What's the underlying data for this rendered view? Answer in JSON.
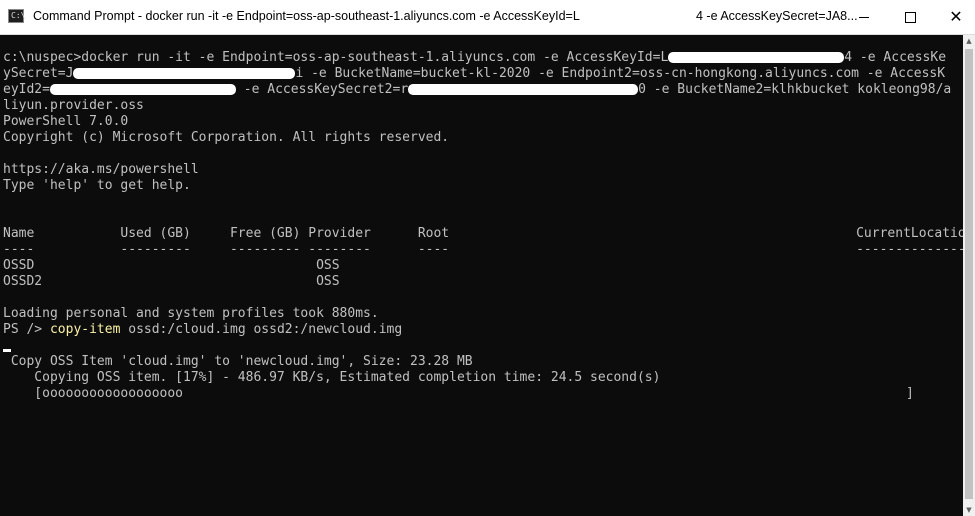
{
  "window": {
    "title_left": "Command Prompt - docker  run -it -e Endpoint=oss-ap-southeast-1.aliyuncs.com -e AccessKeyId=L",
    "title_right": "4 -e AccessKeySecret=JA8...",
    "icon": "cmd-icon",
    "icon_text": "C:\\",
    "buttons": {
      "minimize": "minimize-icon",
      "maximize": "maximize-icon",
      "close": "close-icon",
      "close_glyph": "✕"
    }
  },
  "console": {
    "cmd_line1_a": "c:\\nuspec>docker run -it -e Endpoint=oss-ap-southeast-1.aliyuncs.com -e AccessKeyId=L",
    "cmd_line1_b": "4 -e AccessKe",
    "cmd_line2_a": "ySecret=J",
    "cmd_line2_b": "i -e BucketName=bucket-kl-2020 -e Endpoint2=oss-cn-hongkong.aliyuncs.com -e AccessK",
    "cmd_line3_a": "eyId2=",
    "cmd_line3_b": " -e AccessKeySecret2=r",
    "cmd_line3_c": "0 -e BucketName2=klhkbucket kokleong98/a",
    "cmd_line4": "liyun.provider.oss",
    "ps_version": "PowerShell 7.0.0",
    "copyright": "Copyright (c) Microsoft Corporation. All rights reserved.",
    "url": "https://aka.ms/powershell",
    "help": "Type 'help' to get help.",
    "table": {
      "header": "Name           Used (GB)     Free (GB) Provider      Root                                                    CurrentLocation",
      "dashes": "----           ---------     --------- --------      ----                                                    ---------------",
      "rows": [
        "OSSD                                    OSS",
        "OSSD2                                   OSS"
      ]
    },
    "loading": "Loading personal and system profiles took 880ms.",
    "prompt": "PS /> ",
    "command": "copy-item",
    "command_args": " ossd:/cloud.img ossd2:/newcloud.img",
    "copy_status": " Copy OSS Item 'cloud.img' to 'newcloud.img', Size: 23.28 MB",
    "progress_status": "    Copying OSS item. [17%] - 486.97 KB/s, Estimated completion time: 24.5 second(s)",
    "progress_bar_left": "    [oooooooooooooooooo",
    "progress_bar_right": "]",
    "progress_percent": 17
  }
}
